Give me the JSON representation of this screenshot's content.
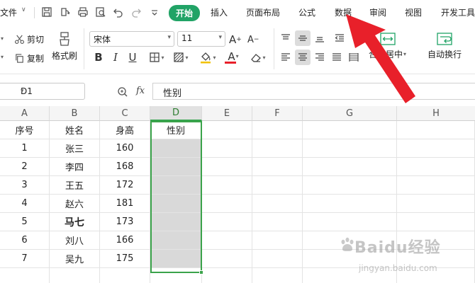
{
  "menubar": {
    "file": "文件",
    "tabs": [
      {
        "id": "start",
        "label": "开始",
        "active": true
      },
      {
        "id": "insert",
        "label": "插入"
      },
      {
        "id": "layout",
        "label": "页面布局"
      },
      {
        "id": "formula",
        "label": "公式"
      },
      {
        "id": "data",
        "label": "数据"
      },
      {
        "id": "review",
        "label": "审阅"
      },
      {
        "id": "view",
        "label": "视图"
      },
      {
        "id": "dev",
        "label": "开发工具"
      }
    ]
  },
  "ribbon": {
    "cut": "剪切",
    "copy": "复制",
    "format_painter": "格式刷",
    "font_name": "宋体",
    "font_size": "11",
    "merge_center": "合并居中",
    "wrap_text": "自动换行",
    "bold": "B",
    "italic": "I",
    "underline": "U",
    "font_color_letter": "A",
    "increase_font": "A",
    "decrease_font": "A"
  },
  "formula_bar": {
    "name_box": "D1",
    "fx": "fx",
    "content": "性别"
  },
  "sheet": {
    "columns": [
      "A",
      "B",
      "C",
      "D",
      "E",
      "F",
      "G",
      "H"
    ],
    "selected_column": "D",
    "rows": [
      [
        "序号",
        "姓名",
        "身高",
        "性别"
      ],
      [
        "1",
        "张三",
        "160",
        ""
      ],
      [
        "2",
        "李四",
        "168",
        ""
      ],
      [
        "3",
        "王五",
        "172",
        ""
      ],
      [
        "4",
        "赵六",
        "181",
        ""
      ],
      [
        "5",
        "马七",
        "173",
        ""
      ],
      [
        "6",
        "刘八",
        "166",
        ""
      ],
      [
        "7",
        "吴九",
        "175",
        ""
      ]
    ]
  },
  "colors": {
    "accent": "#21a366",
    "selection": "#3aa34a",
    "arrow": "#e8202a"
  },
  "icons": {
    "save": "save-icon",
    "undo": "undo-icon",
    "redo": "redo-icon",
    "print": "print-icon",
    "zoom": "zoom-icon"
  },
  "watermark": {
    "text": "Baidu经验",
    "url": "jingyan.baidu.com"
  }
}
